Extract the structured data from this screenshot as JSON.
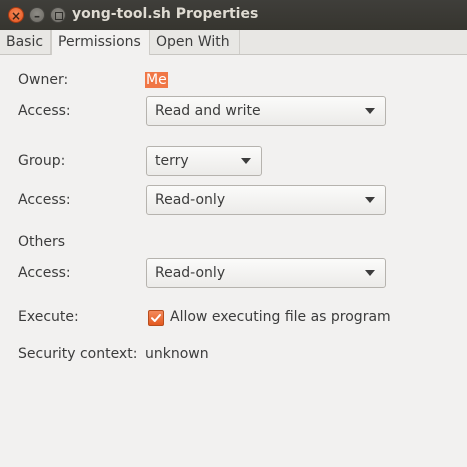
{
  "window": {
    "title": "yong-tool.sh Properties"
  },
  "tabs": [
    {
      "label": "Basic",
      "selected": false
    },
    {
      "label": "Permissions",
      "selected": true
    },
    {
      "label": "Open With",
      "selected": false
    }
  ],
  "owner": {
    "label": "Owner:",
    "value": "Me",
    "access_label": "Access:",
    "access_value": "Read and write"
  },
  "group": {
    "label": "Group:",
    "value": "terry",
    "access_label": "Access:",
    "access_value": "Read-only"
  },
  "others": {
    "label": "Others",
    "access_label": "Access:",
    "access_value": "Read-only"
  },
  "execute": {
    "label": "Execute:",
    "checkbox_label": "Allow executing file as program",
    "checked": true
  },
  "security": {
    "label": "Security context:",
    "value": "unknown"
  },
  "colors": {
    "accent": "#f07746",
    "titlebar": "#3c3b37",
    "background": "#f2f1f0"
  }
}
